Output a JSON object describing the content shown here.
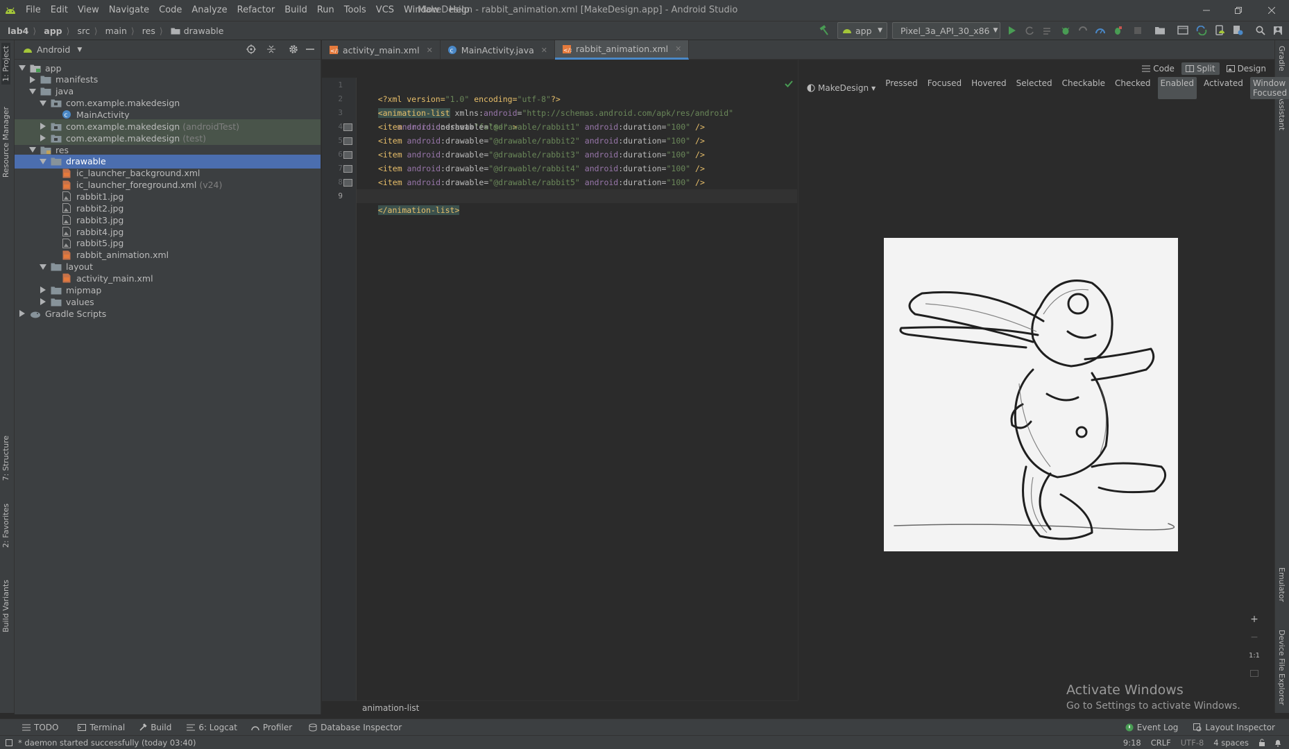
{
  "menubar": {
    "items": [
      "File",
      "Edit",
      "View",
      "Navigate",
      "Code",
      "Analyze",
      "Refactor",
      "Build",
      "Run",
      "Tools",
      "VCS",
      "Window",
      "Help"
    ],
    "window_title": "MakeDesign - rabbit_animation.xml [MakeDesign.app] - Android Studio"
  },
  "navbar": {
    "breadcrumbs": [
      "lab4",
      "app",
      "src",
      "main",
      "res",
      "drawable"
    ],
    "run_config": "app",
    "device": "Pixel_3a_API_30_x86"
  },
  "left_tool_tabs": {
    "project": "1: Project",
    "resource_manager": "Resource Manager",
    "structure": "7: Structure",
    "favorites": "2: Favorites",
    "build_variants": "Build Variants"
  },
  "right_tool_tabs": {
    "gradle": "Gradle",
    "assistant": "Assistant",
    "emulator": "Emulator",
    "device_file_explorer": "Device File Explorer"
  },
  "project_panel": {
    "view_mode": "Android",
    "tree": [
      {
        "label": "app",
        "hint": "",
        "icon": "module-folder-icon",
        "arrow": "down",
        "indent": 0
      },
      {
        "label": "manifests",
        "hint": "",
        "icon": "folder-icon",
        "arrow": "right",
        "indent": 1
      },
      {
        "label": "java",
        "hint": "",
        "icon": "folder-icon",
        "arrow": "down",
        "indent": 1
      },
      {
        "label": "com.example.makedesign",
        "hint": "",
        "icon": "package-icon",
        "arrow": "down",
        "indent": 2
      },
      {
        "label": "MainActivity",
        "hint": "",
        "icon": "class-icon",
        "arrow": "",
        "indent": 3
      },
      {
        "label": "com.example.makedesign",
        "hint": "(androidTest)",
        "icon": "package-icon",
        "arrow": "right",
        "indent": 2,
        "test": true
      },
      {
        "label": "com.example.makedesign",
        "hint": "(test)",
        "icon": "package-icon",
        "arrow": "right",
        "indent": 2,
        "test": true
      },
      {
        "label": "res",
        "hint": "",
        "icon": "res-folder-icon",
        "arrow": "down",
        "indent": 1
      },
      {
        "label": "drawable",
        "hint": "",
        "icon": "folder-icon",
        "arrow": "down",
        "indent": 2,
        "selected": true
      },
      {
        "label": "ic_launcher_background.xml",
        "hint": "",
        "icon": "xml-file-icon",
        "arrow": "",
        "indent": 3
      },
      {
        "label": "ic_launcher_foreground.xml",
        "hint": "(v24)",
        "icon": "xml-file-icon",
        "arrow": "",
        "indent": 3
      },
      {
        "label": "rabbit1.jpg",
        "hint": "",
        "icon": "image-file-icon",
        "arrow": "",
        "indent": 3
      },
      {
        "label": "rabbit2.jpg",
        "hint": "",
        "icon": "image-file-icon",
        "arrow": "",
        "indent": 3
      },
      {
        "label": "rabbit3.jpg",
        "hint": "",
        "icon": "image-file-icon",
        "arrow": "",
        "indent": 3
      },
      {
        "label": "rabbit4.jpg",
        "hint": "",
        "icon": "image-file-icon",
        "arrow": "",
        "indent": 3
      },
      {
        "label": "rabbit5.jpg",
        "hint": "",
        "icon": "image-file-icon",
        "arrow": "",
        "indent": 3
      },
      {
        "label": "rabbit_animation.xml",
        "hint": "",
        "icon": "xml-file-icon",
        "arrow": "",
        "indent": 3
      },
      {
        "label": "layout",
        "hint": "",
        "icon": "folder-icon",
        "arrow": "down",
        "indent": 2
      },
      {
        "label": "activity_main.xml",
        "hint": "",
        "icon": "xml-file-icon",
        "arrow": "",
        "indent": 3
      },
      {
        "label": "mipmap",
        "hint": "",
        "icon": "folder-icon",
        "arrow": "right",
        "indent": 2
      },
      {
        "label": "values",
        "hint": "",
        "icon": "folder-icon",
        "arrow": "right",
        "indent": 2
      },
      {
        "label": "Gradle Scripts",
        "hint": "",
        "icon": "gradle-icon",
        "arrow": "right",
        "indent": 0
      }
    ]
  },
  "editor": {
    "tabs": [
      {
        "label": "activity_main.xml",
        "icon": "xml-file-icon",
        "active": false
      },
      {
        "label": "MainActivity.java",
        "icon": "class-icon",
        "active": false
      },
      {
        "label": "rabbit_animation.xml",
        "icon": "xml-file-icon",
        "active": true
      }
    ],
    "line_numbers": [
      "1",
      "2",
      "3",
      "4",
      "5",
      "6",
      "7",
      "8",
      "9"
    ],
    "code": {
      "l1": [
        "<?xml version=",
        "\"1.0\"",
        " encoding=",
        "\"utf-8\"",
        "?>"
      ],
      "l2": [
        "<animation-list",
        " xmlns:",
        "android",
        "=",
        "\"http://schemas.android.com/apk/res/android\""
      ],
      "l3": [
        "android",
        ":oneshot=",
        "\"false\"",
        " >"
      ],
      "items": [
        [
          "<item ",
          "android",
          ":drawable=",
          "\"@drawable/rabbit1\"",
          " ",
          "android",
          ":duration=",
          "\"100\"",
          " />"
        ],
        [
          "<item ",
          "android",
          ":drawable=",
          "\"@drawable/rabbit2\"",
          " ",
          "android",
          ":duration=",
          "\"100\"",
          " />"
        ],
        [
          "<item ",
          "android",
          ":drawable=",
          "\"@drawable/rabbit3\"",
          " ",
          "android",
          ":duration=",
          "\"100\"",
          " />"
        ],
        [
          "<item ",
          "android",
          ":drawable=",
          "\"@drawable/rabbit4\"",
          " ",
          "android",
          ":duration=",
          "\"100\"",
          " />"
        ],
        [
          "<item ",
          "android",
          ":drawable=",
          "\"@drawable/rabbit5\"",
          " ",
          "android",
          ":duration=",
          "\"100\"",
          " />"
        ]
      ],
      "l9": "</animation-list>"
    },
    "breadcrumb": "animation-list"
  },
  "design": {
    "view_modes": {
      "code": "Code",
      "split": "Split",
      "design": "Design"
    },
    "theme": "MakeDesign",
    "states": [
      {
        "label": "Pressed",
        "on": false
      },
      {
        "label": "Focused",
        "on": false
      },
      {
        "label": "Hovered",
        "on": false
      },
      {
        "label": "Selected",
        "on": false
      },
      {
        "label": "Checkable",
        "on": false
      },
      {
        "label": "Checked",
        "on": false
      },
      {
        "label": "Enabled",
        "on": true
      },
      {
        "label": "Activated",
        "on": false
      },
      {
        "label": "Window Focused",
        "on": true
      }
    ],
    "zoom_reset": "1:1",
    "watermark_title": "Activate Windows",
    "watermark_sub": "Go to Settings to activate Windows."
  },
  "bottom_tools": {
    "todo": "TODO",
    "terminal": "Terminal",
    "build": "Build",
    "logcat": "6: Logcat",
    "profiler": "Profiler",
    "database_inspector": "Database Inspector",
    "event_log": "Event Log",
    "layout_inspector": "Layout Inspector"
  },
  "statusbar": {
    "message": "* daemon started successfully (today 03:40)",
    "position": "9:18",
    "line_sep": "CRLF",
    "encoding": "UTF-8",
    "indent": "4 spaces"
  },
  "colors": {
    "accent": "#4b6eaf",
    "run_green": "#499c54",
    "android_green": "#a4c639"
  }
}
